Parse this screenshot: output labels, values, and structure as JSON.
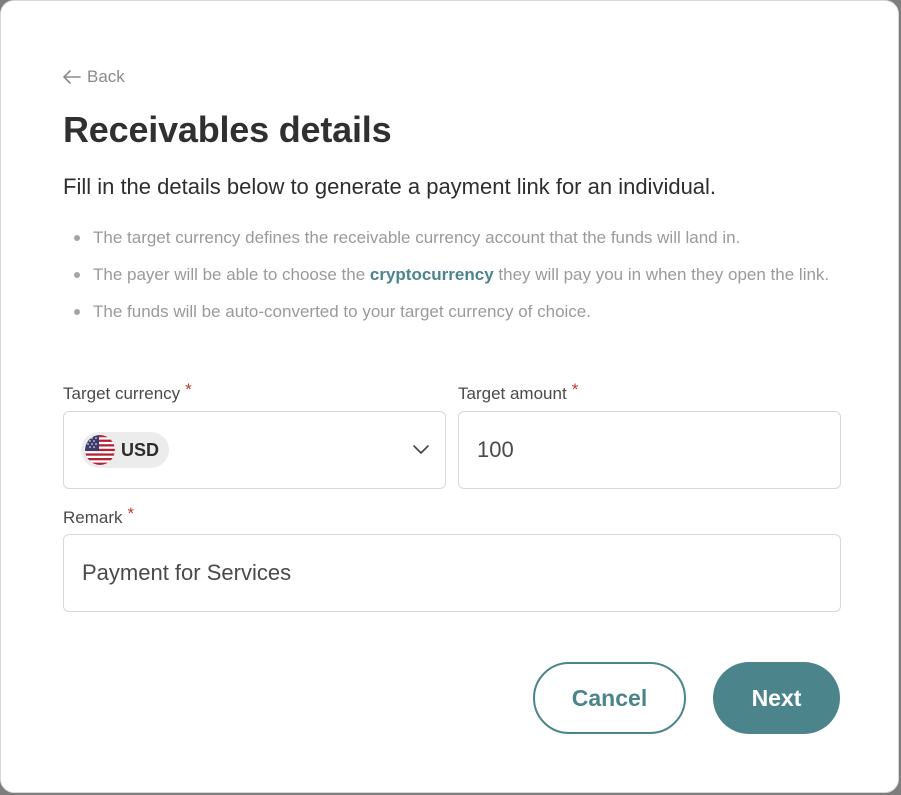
{
  "back": {
    "label": "Back"
  },
  "title": "Receivables details",
  "subtitle": "Fill in the details below to generate a payment link for an individual.",
  "bullets": {
    "item1": "The target currency defines the receivable currency account that the funds will land in.",
    "item2_prefix": "The payer will be able to choose the ",
    "item2_link": "cryptocurrency",
    "item2_suffix": " they will pay you in when they open the link.",
    "item3": "The funds will be auto-converted to your target currency of choice."
  },
  "form": {
    "target_currency": {
      "label": "Target currency",
      "required_mark": "*",
      "value": "USD",
      "flag_icon": "us-flag-icon"
    },
    "target_amount": {
      "label": "Target amount",
      "required_mark": "*",
      "value": "100"
    },
    "remark": {
      "label": "Remark",
      "required_mark": "*",
      "value": "Payment for Services"
    }
  },
  "actions": {
    "cancel_label": "Cancel",
    "next_label": "Next"
  },
  "colors": {
    "accent": "#4b858b",
    "required": "#c0392b",
    "title": "#303030",
    "muted": "#9a9a9a"
  }
}
